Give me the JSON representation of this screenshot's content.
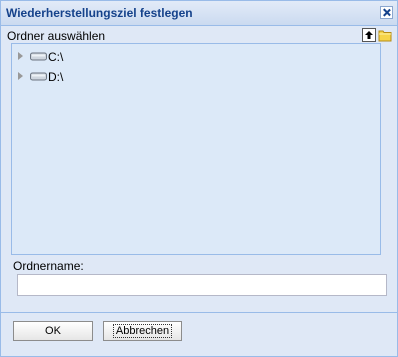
{
  "dialog": {
    "title": "Wiederherstellungsziel festlegen"
  },
  "browser": {
    "label": "Ordner auswählen",
    "tools": [
      "up-folder-icon",
      "new-folder-icon"
    ],
    "tree": [
      {
        "label": "C:\\",
        "icon": "hard-drive-icon",
        "expanded": false
      },
      {
        "label": "D:\\",
        "icon": "hard-drive-icon",
        "expanded": false
      }
    ]
  },
  "folder_name": {
    "label": "Ordnername:",
    "value": ""
  },
  "buttons": {
    "ok": "OK",
    "cancel": "Abbrechen"
  }
}
